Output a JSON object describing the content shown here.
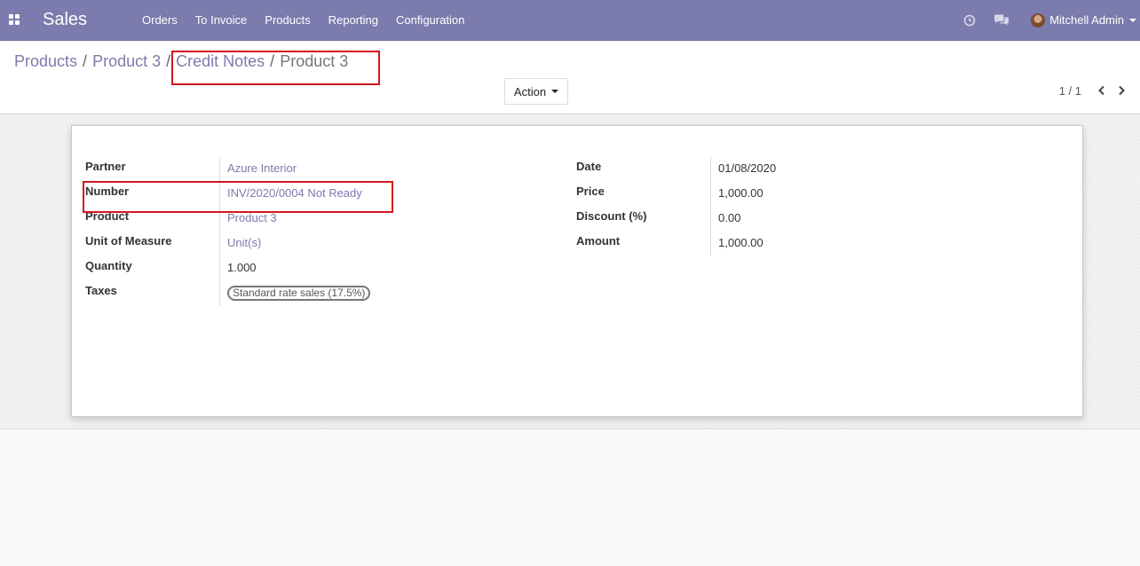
{
  "navbar": {
    "app_name": "Sales",
    "menu": [
      "Orders",
      "To Invoice",
      "Products",
      "Reporting",
      "Configuration"
    ],
    "user_name": "Mitchell Admin",
    "icons": [
      "apps-grid-icon",
      "clock-icon",
      "chat-icon"
    ],
    "background_color": "#7c7bad"
  },
  "breadcrumb": {
    "items": [
      "Products",
      "Product 3",
      "Credit Notes"
    ],
    "current": "Product 3",
    "separator": "/"
  },
  "control_panel": {
    "action_label": "Action",
    "pager": "1 / 1"
  },
  "form": {
    "left": [
      {
        "label": "Partner",
        "value": "Azure Interior",
        "link": true
      },
      {
        "label": "Number",
        "value": "INV/2020/0004 Not Ready",
        "link": true
      },
      {
        "label": "Product",
        "value": "Product 3",
        "link": true
      },
      {
        "label": "Unit of Measure",
        "value": "Unit(s)",
        "link": true
      },
      {
        "label": "Quantity",
        "value": "1.000",
        "link": false
      },
      {
        "label": "Taxes",
        "value": "Standard rate sales (17.5%)",
        "tag": true
      }
    ],
    "right": [
      {
        "label": "Date",
        "value": "01/08/2020"
      },
      {
        "label": "Price",
        "value": "1,000.00"
      },
      {
        "label": "Discount (%)",
        "value": "0.00"
      },
      {
        "label": "Amount",
        "value": "1,000.00"
      }
    ]
  },
  "colors": {
    "accent": "#7c7bad",
    "highlight": "#d0181e"
  }
}
